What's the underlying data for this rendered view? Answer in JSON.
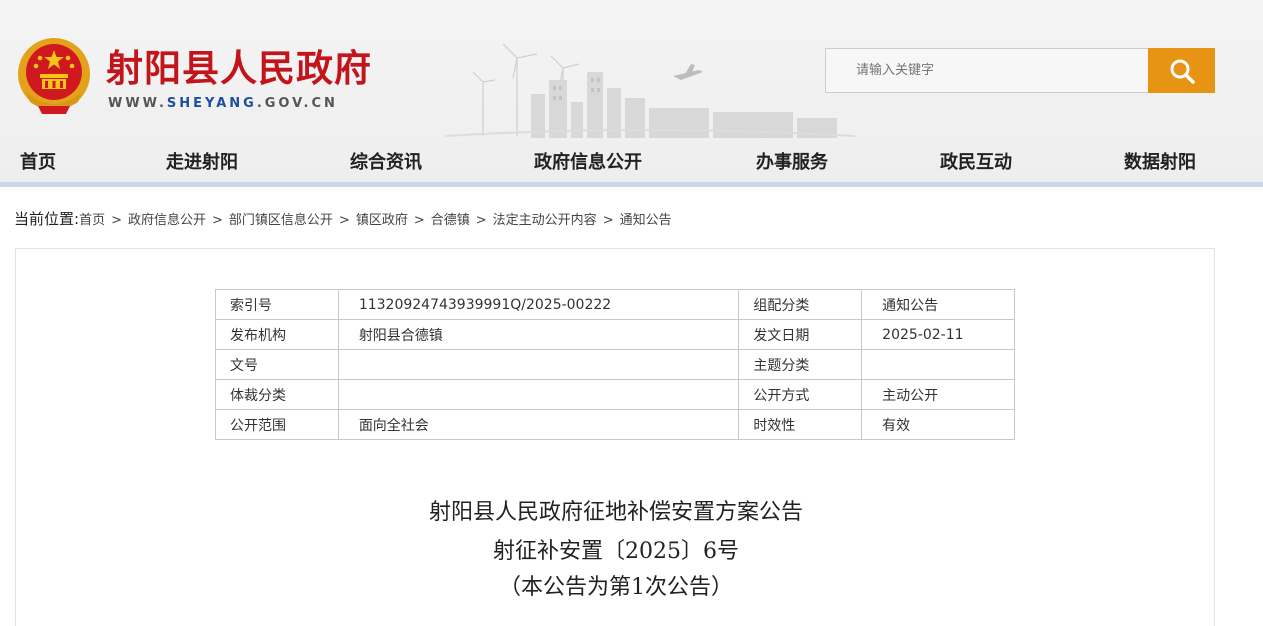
{
  "header": {
    "site_title": "射阳县人民政府",
    "url_prefix": "WWW.",
    "url_mid": "SHEYANG",
    "url_suffix": ".GOV.CN",
    "emblem_icon": "national-emblem-icon",
    "colors": {
      "title": "#c2141a",
      "accent": "#e79314",
      "url_mid": "#1d4f9e"
    }
  },
  "search": {
    "placeholder": "请输入关键字",
    "button_icon": "search-icon"
  },
  "nav": {
    "items": [
      {
        "label": "首页"
      },
      {
        "label": "走进射阳"
      },
      {
        "label": "综合资讯"
      },
      {
        "label": "政府信息公开"
      },
      {
        "label": "办事服务"
      },
      {
        "label": "政民互动"
      },
      {
        "label": "数据射阳"
      }
    ]
  },
  "breadcrumb": {
    "lead": "当前位置:",
    "items": [
      "首页",
      "政府信息公开",
      "部门镇区信息公开",
      "镇区政府",
      "合德镇",
      "法定主动公开内容",
      "通知公告"
    ],
    "separator": ">"
  },
  "meta": {
    "rows": [
      {
        "k1": "索引号",
        "v1": "11320924743939991Q/2025-00222",
        "k2": "组配分类",
        "v2": "通知公告"
      },
      {
        "k1": "发布机构",
        "v1": "射阳县合德镇",
        "k2": "发文日期",
        "v2": "2025-02-11"
      },
      {
        "k1": "文号",
        "v1": "",
        "k2": "主题分类",
        "v2": ""
      },
      {
        "k1": "体裁分类",
        "v1": "",
        "k2": "公开方式",
        "v2": "主动公开"
      },
      {
        "k1": "公开范围",
        "v1": "面向全社会",
        "k2": "时效性",
        "v2": "有效"
      }
    ]
  },
  "document": {
    "title": "射阳县人民政府征地补偿安置方案公告",
    "number": "射征补安置〔2025〕6号",
    "note": "（本公告为第1次公告）"
  }
}
